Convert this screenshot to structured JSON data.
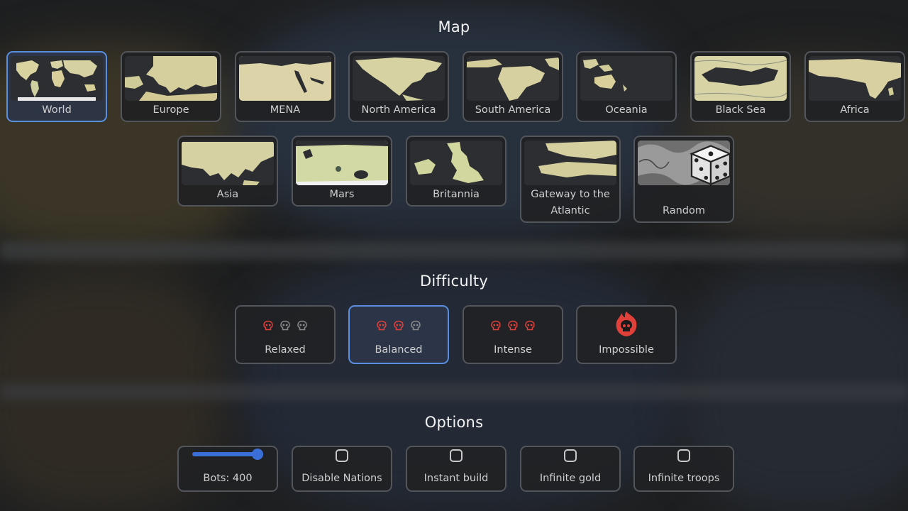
{
  "sections": {
    "map_title": "Map",
    "difficulty_title": "Difficulty",
    "options_title": "Options"
  },
  "maps": [
    {
      "label": "World",
      "selected": true
    },
    {
      "label": "Europe",
      "selected": false
    },
    {
      "label": "MENA",
      "selected": false
    },
    {
      "label": "North America",
      "selected": false
    },
    {
      "label": "South America",
      "selected": false
    },
    {
      "label": "Oceania",
      "selected": false
    },
    {
      "label": "Black Sea",
      "selected": false
    },
    {
      "label": "Africa",
      "selected": false
    },
    {
      "label": "Asia",
      "selected": false
    },
    {
      "label": "Mars",
      "selected": false
    },
    {
      "label": "Britannia",
      "selected": false
    },
    {
      "label": "Gateway to the Atlantic",
      "selected": false
    },
    {
      "label": "Random",
      "selected": false
    }
  ],
  "difficulties": [
    {
      "label": "Relaxed",
      "level": 1,
      "selected": false
    },
    {
      "label": "Balanced",
      "level": 2,
      "selected": true
    },
    {
      "label": "Intense",
      "level": 3,
      "selected": false
    },
    {
      "label": "Impossible",
      "level": 4,
      "selected": false
    }
  ],
  "options": {
    "bots_label": "Bots: 400",
    "bots_value": 400,
    "disable_nations": {
      "label": "Disable Nations",
      "checked": false
    },
    "instant_build": {
      "label": "Instant build",
      "checked": false
    },
    "infinite_gold": {
      "label": "Infinite gold",
      "checked": false
    },
    "infinite_troops": {
      "label": "Infinite troops",
      "checked": false
    }
  },
  "colors": {
    "accent": "#5a8fe0",
    "slider": "#3b6fd8",
    "skull_active": "#e0403a",
    "skull_inactive": "#8a8a8a",
    "land": "#d8d3a2",
    "water": "#2c2e31"
  }
}
